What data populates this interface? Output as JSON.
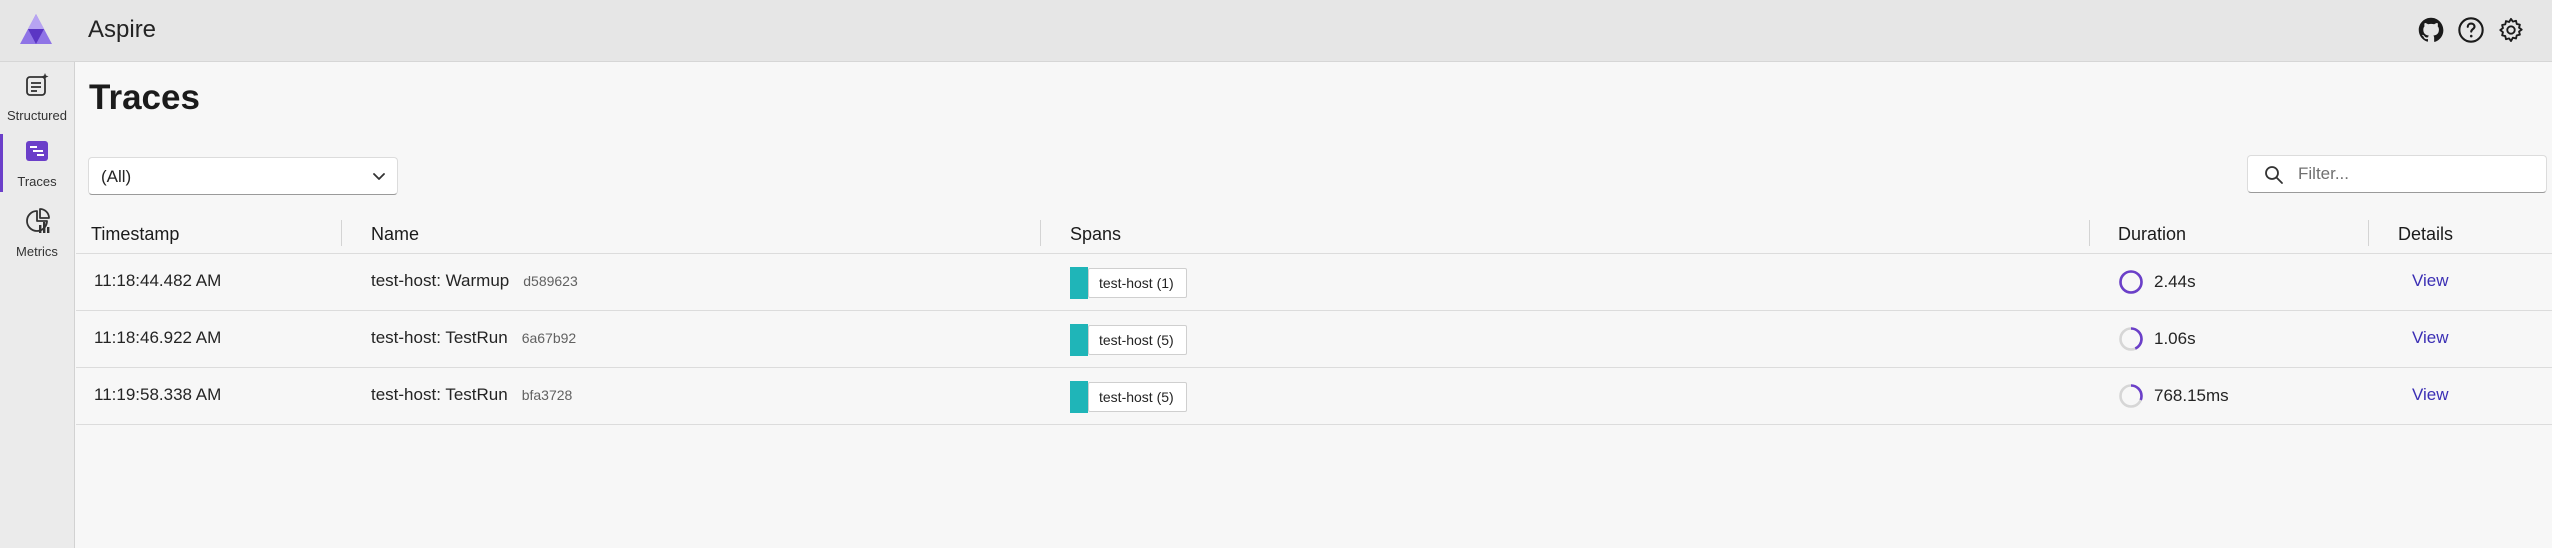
{
  "app": {
    "title": "Aspire",
    "accent": "#6b3fc9"
  },
  "topbar": {
    "icons": [
      "github-icon",
      "help-icon",
      "settings-icon"
    ]
  },
  "sidebar": {
    "items": [
      {
        "label": "Structured",
        "icon": "structured-logs-icon",
        "active": false
      },
      {
        "label": "Traces",
        "icon": "traces-icon",
        "active": true
      },
      {
        "label": "Metrics",
        "icon": "metrics-icon",
        "active": false
      }
    ]
  },
  "page": {
    "title": "Traces",
    "resource_select": {
      "value": "(All)"
    },
    "filter": {
      "placeholder": "Filter...",
      "value": ""
    }
  },
  "table": {
    "headers": [
      "Timestamp",
      "Name",
      "Spans",
      "Duration",
      "Details"
    ],
    "rows": [
      {
        "timestamp": "11:18:44.482 AM",
        "name": "test-host: Warmup",
        "trace_id": "d589623",
        "span_label": "test-host (1)",
        "duration": "2.44s",
        "duration_fraction": 1.0,
        "details": "View"
      },
      {
        "timestamp": "11:18:46.922 AM",
        "name": "test-host: TestRun",
        "trace_id": "6a67b92",
        "span_label": "test-host (5)",
        "duration": "1.06s",
        "duration_fraction": 0.43,
        "details": "View"
      },
      {
        "timestamp": "11:19:58.338 AM",
        "name": "test-host: TestRun",
        "trace_id": "bfa3728",
        "span_label": "test-host (5)",
        "duration": "768.15ms",
        "duration_fraction": 0.31,
        "details": "View"
      }
    ]
  },
  "colors": {
    "span_bar": "#1fb5b8",
    "duration_ring": "#6b3fc9",
    "duration_track": "#d6d6d6",
    "link": "#3b2fb4"
  }
}
